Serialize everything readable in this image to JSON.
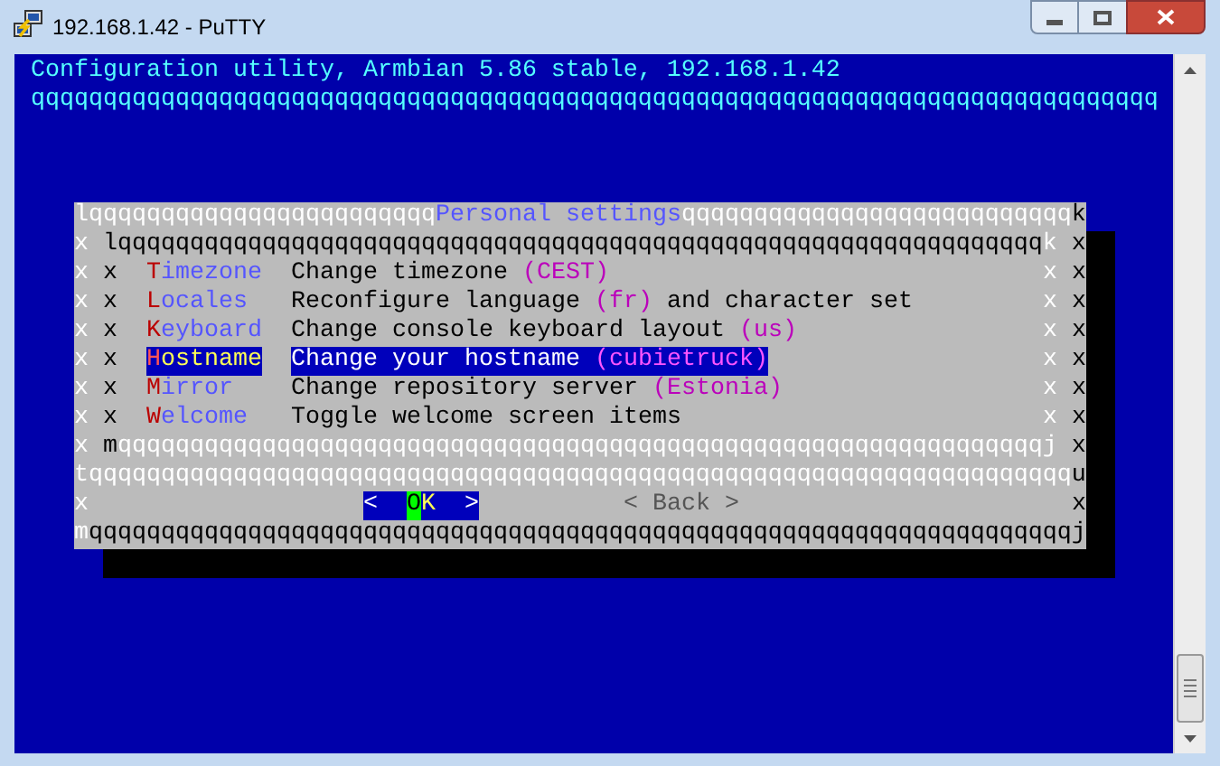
{
  "window": {
    "title": "192.168.1.42 - PuTTY"
  },
  "terminal": {
    "header": "Configuration utility, Armbian 5.86 stable, 192.168.1.42",
    "header_rule": "qqqqqqqqqqqqqqqqqqqqqqqqqqqqqqqqqqqqqqqqqqqqqqqqqqqqqqqqqqqqqqqqqqqqqqqqqqqqqq",
    "dialog": {
      "rows": [
        {
          "kind": "frame",
          "segments": [
            {
              "kind": "light",
              "text": "lqqqqqqqqqqqqqqqqqqqqqqqq"
            },
            {
              "kind": "title",
              "text": "Personal settings"
            },
            {
              "kind": "light",
              "text": "qqqqqqqqqqqqqqqqqqqqqqqqqqq"
            },
            {
              "kind": "dark",
              "text": "k"
            }
          ]
        },
        {
          "kind": "frame",
          "segments": [
            {
              "kind": "light",
              "text": "x"
            },
            {
              "kind": "dark",
              "text": " lqqqqqqqqqqqqqqqqqqqqqqqqqqqqqqqqqqqqqqqqqqqqqqqqqqqqqqqqqqqqqqqq"
            },
            {
              "kind": "light",
              "text": "k"
            },
            {
              "kind": "dark",
              "text": " x"
            }
          ]
        },
        {
          "kind": "menu",
          "left_border": "x",
          "inner_left": "x",
          "label": "Timezone",
          "description": "Change timezone",
          "note": "(CEST)",
          "inner_right": "x",
          "right_border": "x",
          "selected": false
        },
        {
          "kind": "menu",
          "left_border": "x",
          "inner_left": "x",
          "label": "Locales",
          "description": "Reconfigure language",
          "note": "(fr)",
          "description_after": "and character set",
          "inner_right": "x",
          "right_border": "x",
          "selected": false
        },
        {
          "kind": "menu",
          "left_border": "x",
          "inner_left": "x",
          "label": "Keyboard",
          "description": "Change console keyboard layout",
          "note": "(us)",
          "inner_right": "x",
          "right_border": "x",
          "selected": false
        },
        {
          "kind": "menu",
          "left_border": "x",
          "inner_left": "x",
          "label": "Hostname",
          "description": "Change your hostname",
          "note": "(cubietruck)",
          "inner_right": "x",
          "right_border": "x",
          "selected": true
        },
        {
          "kind": "menu",
          "left_border": "x",
          "inner_left": "x",
          "label": "Mirror",
          "description": "Change repository server",
          "note": "(Estonia)",
          "inner_right": "x",
          "right_border": "x",
          "selected": false
        },
        {
          "kind": "menu",
          "left_border": "x",
          "inner_left": "x",
          "label": "Welcome",
          "description": "Toggle welcome screen items",
          "inner_right": "x",
          "right_border": "x",
          "selected": false
        },
        {
          "kind": "frame",
          "segments": [
            {
              "kind": "light",
              "text": "x"
            },
            {
              "kind": "dark",
              "text": " m"
            },
            {
              "kind": "light",
              "text": "qqqqqqqqqqqqqqqqqqqqqqqqqqqqqqqqqqqqqqqqqqqqqqqqqqqqqqqqqqqqqqqqj"
            },
            {
              "kind": "dark",
              "text": " x"
            }
          ]
        },
        {
          "kind": "frame",
          "segments": [
            {
              "kind": "light",
              "text": "tqqqqqqqqqqqqqqqqqqqqqqqqqqqqqqqqqqqqqqqqqqqqqqqqqqqqqqqqqqqqqqqqqqqq"
            },
            {
              "kind": "dark",
              "text": "u"
            }
          ]
        },
        {
          "kind": "buttons",
          "left_border": "x",
          "right_border": "x",
          "buttons": [
            {
              "left": "<",
              "label": "OK",
              "right": ">",
              "selected": true
            },
            {
              "left": "<",
              "label": "Back",
              "right": ">",
              "selected": false
            }
          ]
        },
        {
          "kind": "frame",
          "segments": [
            {
              "kind": "light",
              "text": "m"
            },
            {
              "kind": "dark",
              "text": "qqqqqqqqqqqqqqqqqqqqqqqqqqqqqqqqqqqqqqqqqqqqqqqqqqqqqqqqqqqqqqqqqqqqj"
            }
          ]
        }
      ]
    }
  }
}
